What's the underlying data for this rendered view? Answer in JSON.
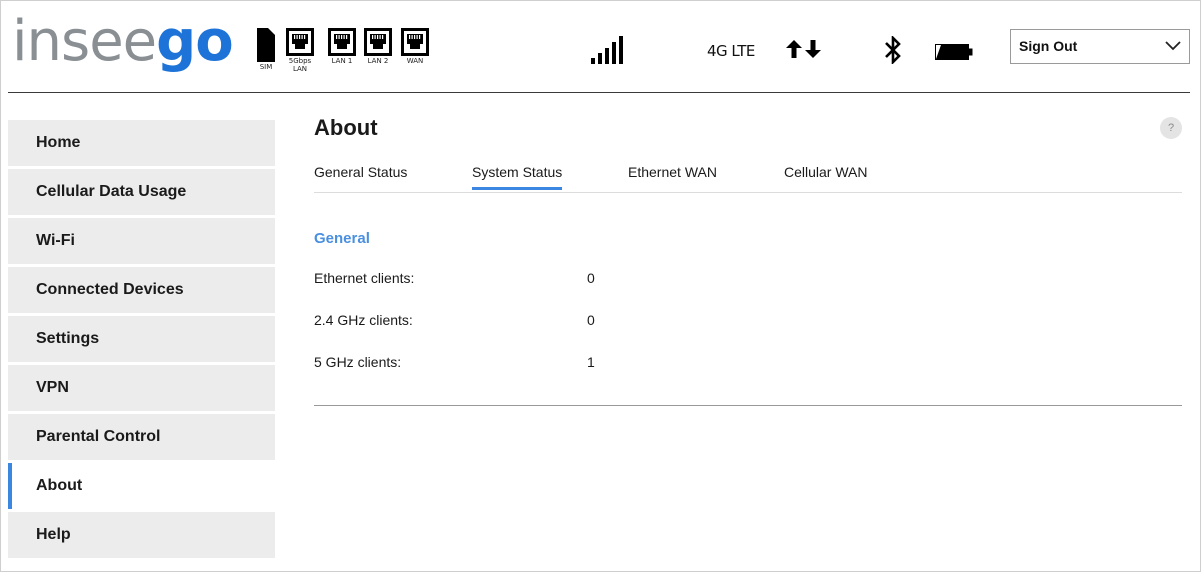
{
  "brand": {
    "logo_light": "insee",
    "logo_bold": "go"
  },
  "status_bar": {
    "ports": [
      {
        "name": "sim",
        "label": "SIM"
      },
      {
        "name": "5gbps-lan",
        "label": "5Gbps LAN"
      },
      {
        "name": "lan1",
        "label": "LAN 1"
      },
      {
        "name": "lan2",
        "label": "LAN 2"
      },
      {
        "name": "wan",
        "label": "WAN"
      }
    ],
    "network_type": "4G LTE",
    "signal_icon": "signal-bars-icon",
    "data_icon": "up-down-arrows-icon",
    "bluetooth_icon": "bluetooth-icon",
    "battery_icon": "battery-icon"
  },
  "account": {
    "signout_label": "Sign Out"
  },
  "sidebar": {
    "items": [
      {
        "label": "Home"
      },
      {
        "label": "Cellular Data Usage"
      },
      {
        "label": "Wi-Fi"
      },
      {
        "label": "Connected Devices"
      },
      {
        "label": "Settings"
      },
      {
        "label": "VPN"
      },
      {
        "label": "Parental Control"
      },
      {
        "label": "About"
      },
      {
        "label": "Help"
      }
    ],
    "active_index": 7
  },
  "main": {
    "title": "About",
    "help_label": "?",
    "tabs": [
      {
        "label": "General Status"
      },
      {
        "label": "System Status"
      },
      {
        "label": "Ethernet WAN"
      },
      {
        "label": "Cellular WAN"
      }
    ],
    "active_tab_index": 1,
    "section_title": "General",
    "rows": [
      {
        "label": "Ethernet clients:",
        "value": "0"
      },
      {
        "label": "2.4 GHz clients:",
        "value": "0"
      },
      {
        "label": "5 GHz clients:",
        "value": "1"
      }
    ]
  },
  "colors": {
    "accent": "#3a86e0",
    "brand_blue": "#1e73d8",
    "brand_gray": "#8a8f94",
    "sidebar_bg": "#ececec"
  }
}
